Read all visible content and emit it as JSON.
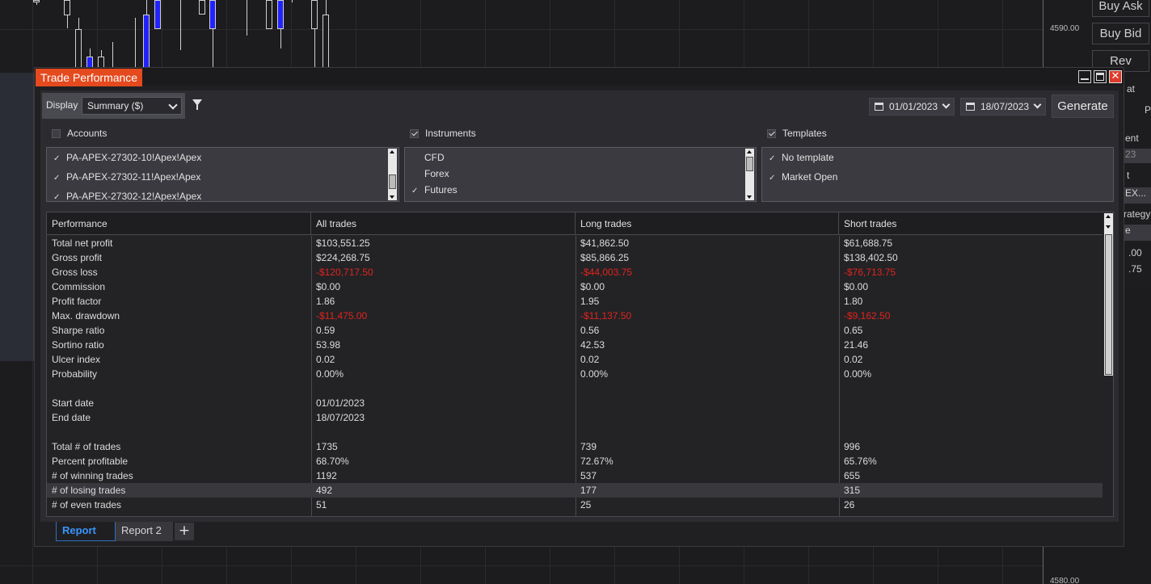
{
  "chart_bg": {
    "price_labels": [
      "4590.00",
      "4580.00"
    ]
  },
  "right_buttons": [
    "Buy Ask",
    "Buy Bid",
    "Rev"
  ],
  "right_peek": [
    "at",
    "Pr",
    "ent",
    "23",
    "t",
    "EX...",
    "rategy",
    "e",
    ".00",
    ".75"
  ],
  "window": {
    "title": "Trade Performance",
    "display_label": "Display",
    "display_value": "Summary ($)",
    "date_from": "01/01/2023",
    "date_to": "18/07/2023",
    "generate_label": "Generate"
  },
  "accounts": {
    "label": "Accounts",
    "checked": false,
    "items": [
      {
        "label": "PA-APEX-27302-10!Apex!Apex",
        "checked": true
      },
      {
        "label": "PA-APEX-27302-11!Apex!Apex",
        "checked": true
      },
      {
        "label": "PA-APEX-27302-12!Apex!Apex",
        "checked": true
      }
    ]
  },
  "instruments": {
    "label": "Instruments",
    "checked": true,
    "items": [
      {
        "label": "CFD",
        "checked": false
      },
      {
        "label": "Forex",
        "checked": false
      },
      {
        "label": "Futures",
        "checked": true
      }
    ]
  },
  "templates": {
    "label": "Templates",
    "checked": true,
    "items": [
      {
        "label": "No template",
        "checked": true
      },
      {
        "label": "Market Open",
        "checked": true
      }
    ]
  },
  "table": {
    "columns": [
      "Performance",
      "All trades",
      "Long trades",
      "Short trades"
    ],
    "rows": [
      [
        "Total net profit",
        "$103,551.25",
        "$41,862.50",
        "$61,688.75"
      ],
      [
        "Gross profit",
        "$224,268.75",
        "$85,866.25",
        "$138,402.50"
      ],
      [
        "Gross loss",
        "-$120,717.50",
        "-$44,003.75",
        "-$76,713.75"
      ],
      [
        "Commission",
        "$0.00",
        "$0.00",
        "$0.00"
      ],
      [
        "Profit factor",
        "1.86",
        "1.95",
        "1.80"
      ],
      [
        "Max. drawdown",
        "-$11,475.00",
        "-$11,137.50",
        "-$9,162.50"
      ],
      [
        "Sharpe ratio",
        "0.59",
        "0.56",
        "0.65"
      ],
      [
        "Sortino ratio",
        "53.98",
        "42.53",
        "21.46"
      ],
      [
        "Ulcer index",
        "0.02",
        "0.02",
        "0.02"
      ],
      [
        "Probability",
        "0.00%",
        "0.00%",
        "0.00%"
      ],
      [
        "",
        "",
        "",
        ""
      ],
      [
        "Start date",
        "01/01/2023",
        "",
        ""
      ],
      [
        "End date",
        "18/07/2023",
        "",
        ""
      ],
      [
        "",
        "",
        "",
        ""
      ],
      [
        "Total # of trades",
        "1735",
        "739",
        "996"
      ],
      [
        "Percent profitable",
        "68.70%",
        "72.67%",
        "65.76%"
      ],
      [
        "# of winning trades",
        "1192",
        "537",
        "655"
      ],
      [
        "# of losing trades",
        "492",
        "177",
        "315"
      ],
      [
        "# of even trades",
        "51",
        "25",
        "26"
      ]
    ],
    "negative_color": "#e0241d",
    "highlighted_row": "# of losing trades"
  },
  "tabs": [
    "Report",
    "Report 2"
  ],
  "active_tab": "Report",
  "add_tab_label": "+",
  "colors": {
    "title_accent": "#e54a1e",
    "active_tab": "#3a96ff",
    "down_candle": "#2222ff"
  }
}
